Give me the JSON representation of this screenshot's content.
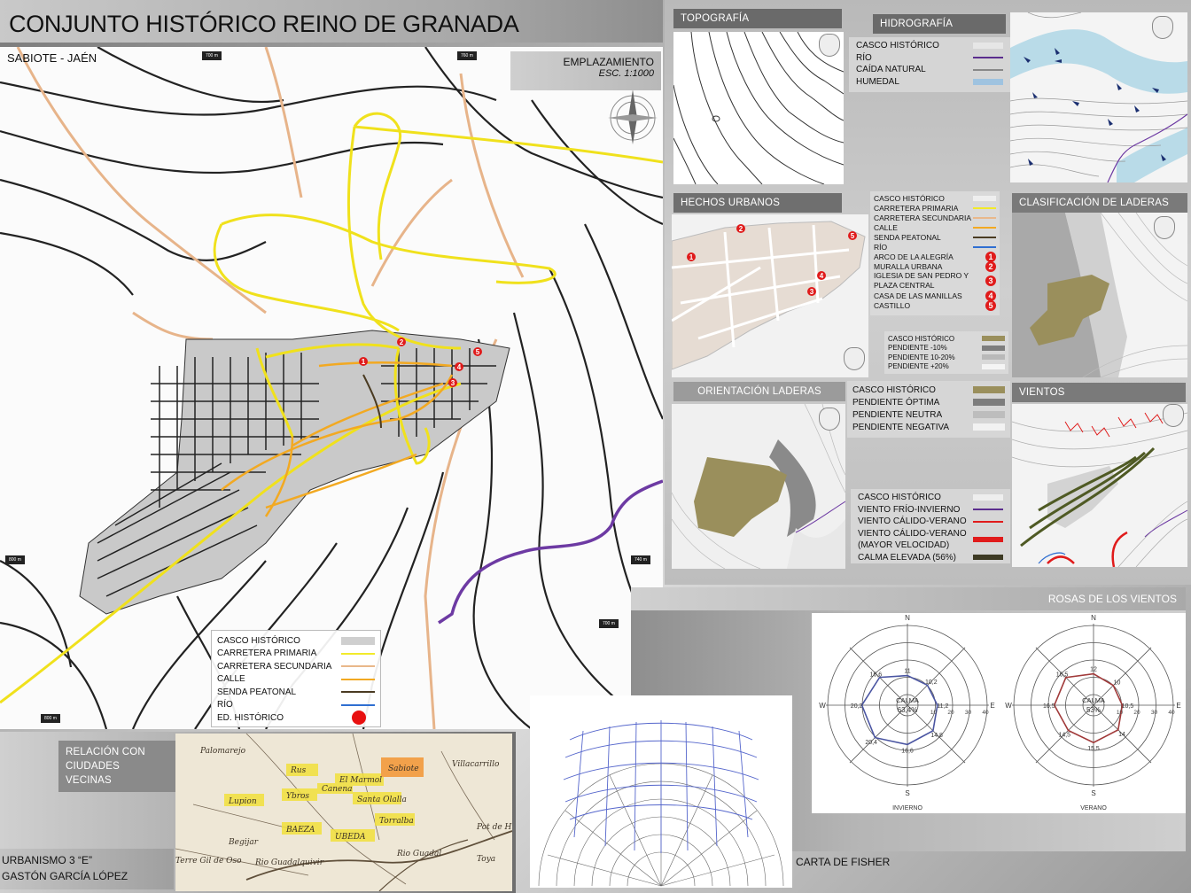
{
  "header": {
    "title": "CONJUNTO HISTÓRICO REINO DE GRANADA",
    "subtitle": "SABIOTE - JAÉN"
  },
  "emplazamiento": {
    "title": "EMPLAZAMIENTO",
    "scale": "ESC. 1:1000"
  },
  "map_labels": [
    "700 m",
    "760 m",
    "800 m",
    "740 m",
    "700 m",
    "800 m"
  ],
  "main_legend": [
    {
      "label": "CASCO HISTÓRICO",
      "color": "#cfcfcf"
    },
    {
      "label": "CARRETERA PRIMARIA",
      "color": "#f2ea2a"
    },
    {
      "label": "CARRETERA SECUNDARIA",
      "color": "#e9b88a"
    },
    {
      "label": "CALLE",
      "color": "#f2a922"
    },
    {
      "label": "SENDA PEATONAL",
      "color": "#4a3b22"
    },
    {
      "label": "RÍO",
      "color": "#2f6fd1"
    },
    {
      "label": "ED. HISTÓRICO",
      "color": "#e81010"
    }
  ],
  "panels": {
    "topografia": "TOPOGRAFÍA",
    "hidrografia": "HIDROGRAFÍA",
    "hechos": "HECHOS URBANOS",
    "clasificacion": "CLASIFICACIÓN DE LADERAS",
    "orientacion": "ORIENTACIÓN LADERAS",
    "vientos": "VIENTOS",
    "relacion": "RELACIÓN CON CIUDADES VECINAS",
    "rosas": "ROSAS DE LOS VIENTOS",
    "fisher": "CARTA DE FISHER"
  },
  "hidro_legend": [
    {
      "label": "CASCO HISTÓRICO",
      "color": "#dcdcdc"
    },
    {
      "label": "RÍO",
      "color": "#5b2d8e"
    },
    {
      "label": "CAÍDA NATURAL",
      "color": "#888888"
    },
    {
      "label": "HUMEDAL",
      "color": "#9fc3e0"
    }
  ],
  "hechos_legend": [
    {
      "label": "CASCO HISTÓRICO",
      "color": "#dcdcdc"
    },
    {
      "label": "CARRETERA PRIMARIA",
      "color": "#f2ea2a"
    },
    {
      "label": "CARRETERA SECUNDARIA",
      "color": "#e9b88a"
    },
    {
      "label": "CALLE",
      "color": "#f2a922"
    },
    {
      "label": "SENDA PEATONAL",
      "color": "#4a3b22"
    },
    {
      "label": "RÍO",
      "color": "#2f6fd1"
    }
  ],
  "hechos_items": [
    {
      "label": "ARCO DE LA ALEGRÍA",
      "n": "1"
    },
    {
      "label": "MURALLA URBANA",
      "n": "2"
    },
    {
      "label": "IGLESIA DE SAN PEDRO Y PLAZA CENTRAL",
      "n": "3"
    },
    {
      "label": "CASA DE LAS MANILLAS",
      "n": "4"
    },
    {
      "label": "CASTILLO",
      "n": "5"
    }
  ],
  "clasif_legend": [
    {
      "label": "CASCO HISTÓRICO",
      "color": "#9a8f5c"
    },
    {
      "label": "PENDIENTE -10%",
      "color": "#7d7d7d"
    },
    {
      "label": "PENDIENTE 10-20%",
      "color": "#b9b9b9"
    },
    {
      "label": "PENDIENTE +20%",
      "color": "#ececec"
    }
  ],
  "orient_legend": [
    {
      "label": "CASCO HISTÓRICO",
      "color": "#9a8f5c"
    },
    {
      "label": "PENDIENTE ÓPTIMA",
      "color": "#7d7d7d"
    },
    {
      "label": "PENDIENTE NEUTRA",
      "color": "#bdbdbd"
    },
    {
      "label": "PENDIENTE NEGATIVA",
      "color": "#efefef"
    }
  ],
  "vientos_legend": [
    {
      "label": "CASCO HISTÓRICO",
      "color": "#dcdcdc"
    },
    {
      "label": "VIENTO FRÍO-INVIERNO",
      "color": "#5b2d8e"
    },
    {
      "label": "VIENTO CÁLIDO-VERANO",
      "color": "#e01b1b"
    },
    {
      "label": "VIENTO CÁLIDO-VERANO (MAYOR VELOCIDAD)",
      "color": "#e01b1b"
    },
    {
      "label": "CALMA ELEVADA (56%)",
      "color": "#3d3a24"
    }
  ],
  "neighbors": [
    "Palomarejo",
    "Villacarrillo",
    "Rus",
    "El Marmol",
    "Sabiote",
    "Canena",
    "Lupion",
    "Ybros",
    "Santa Olalla",
    "Torralba",
    "BAEZA",
    "UBEDA",
    "Begijar",
    "Rio Guadalquivir",
    "Terre Gil de Oso",
    "Rio Guadal",
    "Pot de H",
    "Toya"
  ],
  "roses": [
    {
      "name": "INVIERNO",
      "calma_label": "CALMA",
      "calma": "63,4%",
      "values": [
        "11",
        "10,2",
        "11,2",
        "14,8",
        "16,6",
        "20,4",
        "20,2",
        "16,6"
      ]
    },
    {
      "name": "VERANO",
      "calma_label": "CALMA",
      "calma": "53%",
      "values": [
        "12",
        "10",
        "10,5",
        "14",
        "15,5",
        "14,5",
        "16,5",
        "16,5"
      ]
    }
  ],
  "rose_dirs": [
    "N",
    "E",
    "S",
    "W"
  ],
  "rose_scale": [
    "10",
    "20",
    "30",
    "40"
  ],
  "footer": {
    "line1": "URBANISMO 3 “E”",
    "line2": "GASTÓN GARCÍA LÓPEZ"
  }
}
